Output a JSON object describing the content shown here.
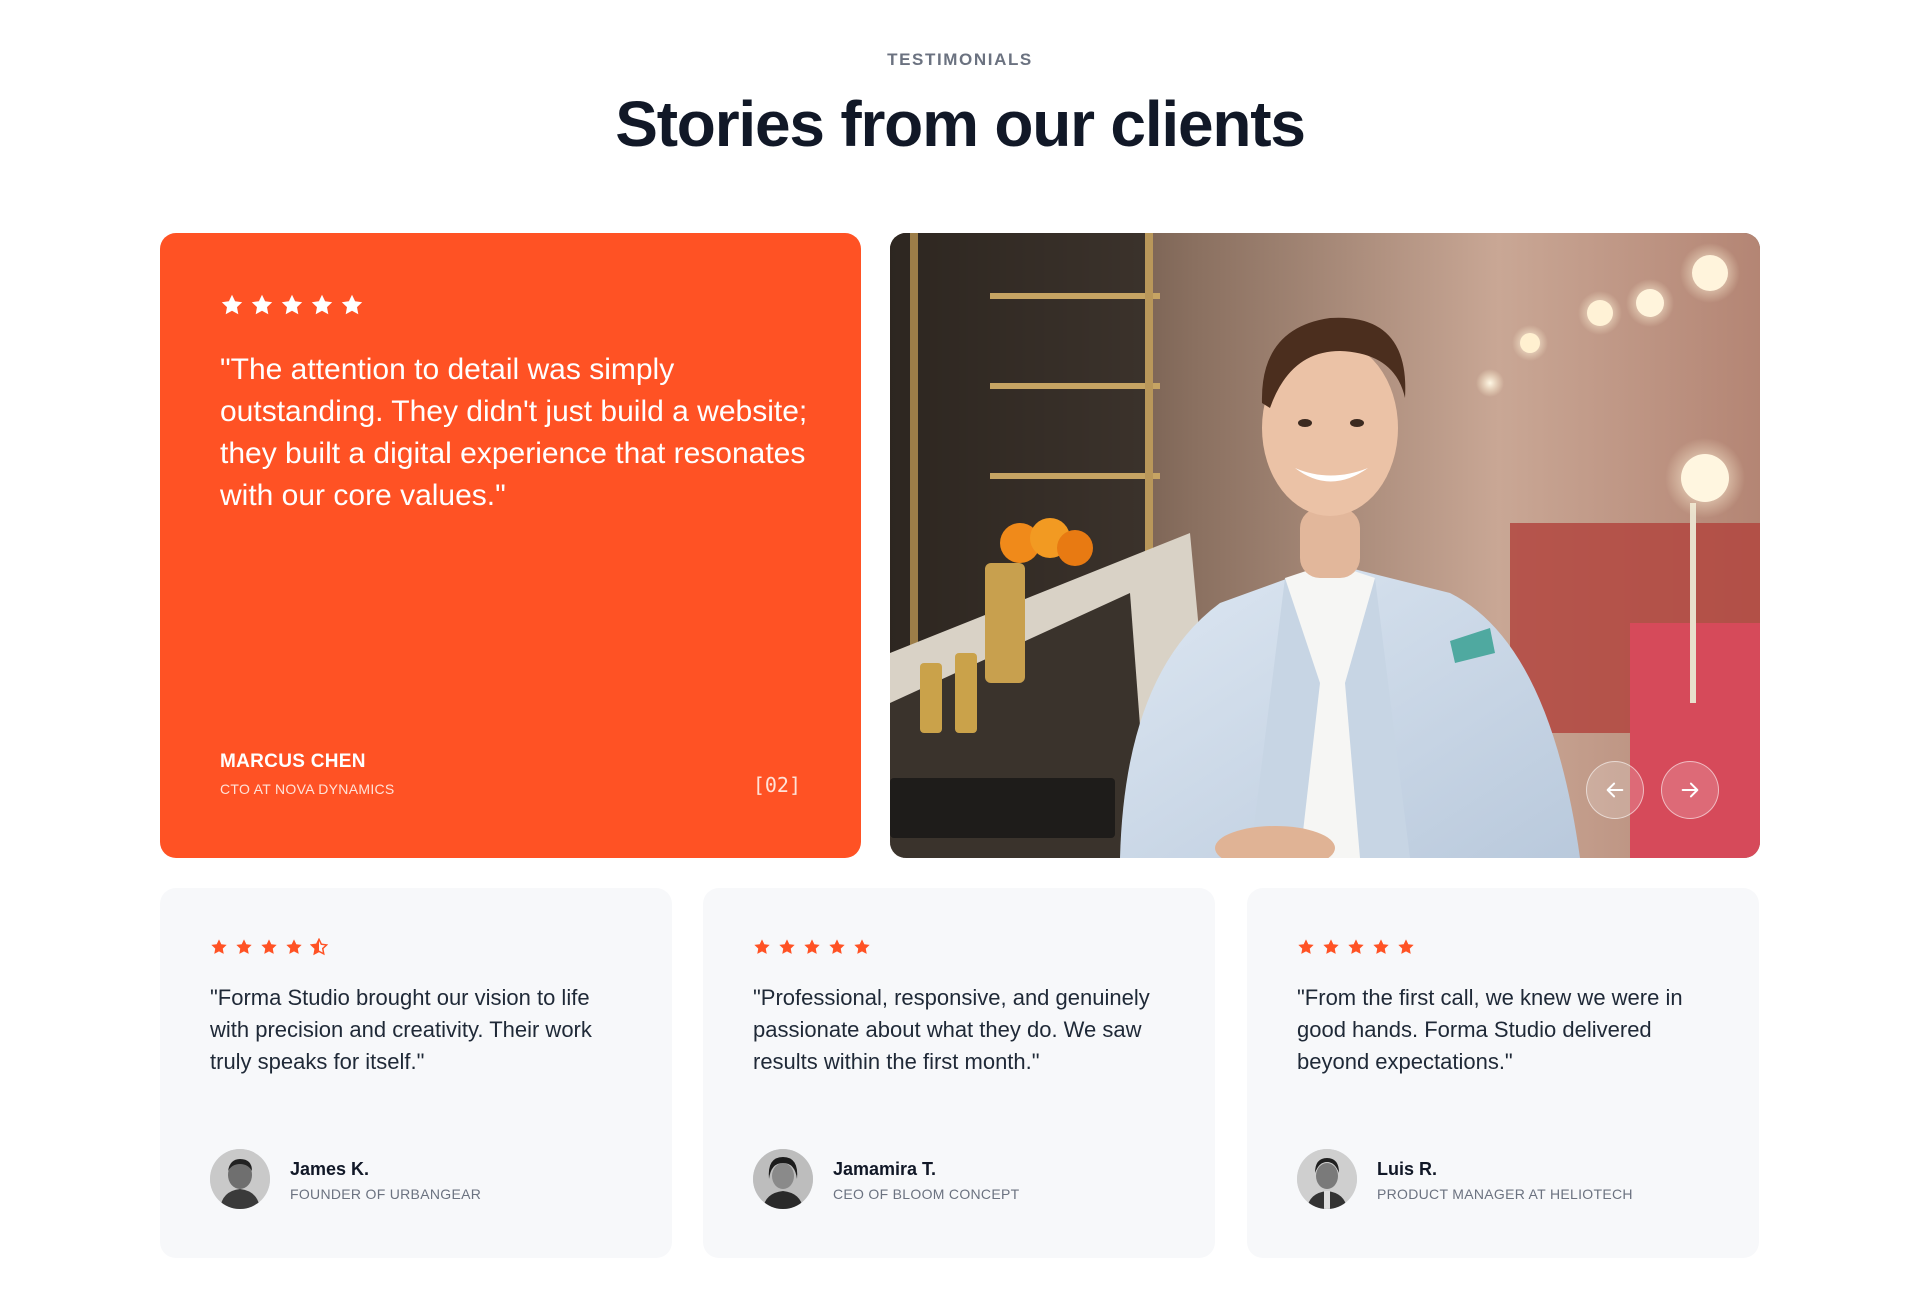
{
  "section": {
    "eyebrow": "TESTIMONIALS",
    "title": "Stories from our clients"
  },
  "featured": {
    "rating": 5,
    "quote": "\"The attention to detail was simply outstanding. They didn't just build a website; they built a digital experience that resonates with our core values.\"",
    "name": "MARCUS CHEN",
    "role": "CTO AT NOVA DYNAMICS",
    "index": "[02]",
    "background_color": "#ff5224",
    "photo": "smiling-man-in-light-blue-blazer-at-restaurant-bar"
  },
  "carousel": {
    "prev_icon": "arrow-left-icon",
    "next_icon": "arrow-right-icon"
  },
  "testimonials": [
    {
      "rating": 4.5,
      "quote": "\"Forma Studio brought our vision to life with precision and creativity. Their work truly speaks for itself.\"",
      "name": "James K.",
      "role": "FOUNDER OF URBANGEAR"
    },
    {
      "rating": 5,
      "quote": "\"Professional, responsive, and genuinely passionate about what they do. We saw results within the first month.\"",
      "name": "Jamamira T.",
      "role": "CEO OF BLOOM CONCEPT"
    },
    {
      "rating": 5,
      "quote": "\"From the first call, we knew we were in good hands. Forma Studio delivered beyond expectations.\"",
      "name": "Luis R.",
      "role": "PRODUCT MANAGER AT HELIOTECH"
    }
  ],
  "colors": {
    "accent": "#ff5224",
    "heading": "#111827",
    "muted": "#6b7280",
    "card_bg": "#f7f8fa"
  }
}
